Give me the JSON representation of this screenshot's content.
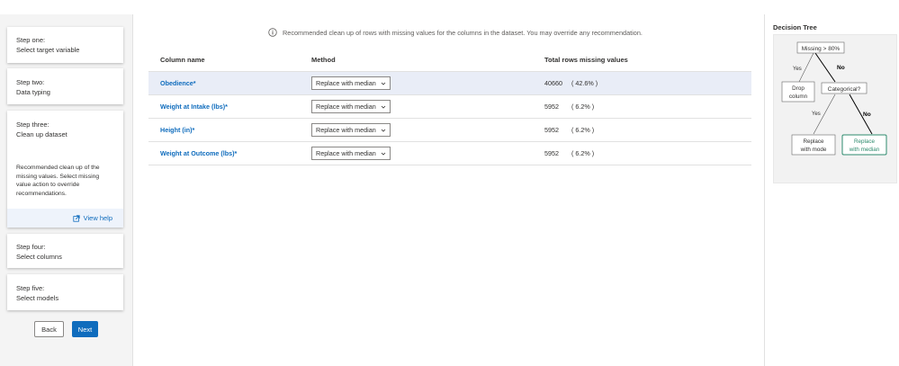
{
  "steps": [
    {
      "label": "Step one:",
      "value": "Select target variable"
    },
    {
      "label": "Step two:",
      "value": "Data typing"
    },
    {
      "label": "Step three:",
      "value": "Clean up dataset",
      "description": "Recommended clean up of the missing values. Select missing value action to override recommendations.",
      "help": "View help"
    },
    {
      "label": "Step four:",
      "value": "Select columns"
    },
    {
      "label": "Step five:",
      "value": "Select models"
    }
  ],
  "buttons": {
    "back": "Back",
    "next": "Next"
  },
  "notice": "Recommended clean up of rows with missing values for the columns in the dataset. You may override any recommendation.",
  "table": {
    "headers": [
      "Column name",
      "Method",
      "Total rows missing values"
    ],
    "rows": [
      {
        "name": "Obedience*",
        "method": "Replace with median",
        "count": "40660",
        "pct": "( 42.6% )",
        "selected": true
      },
      {
        "name": "Weight at Intake (lbs)*",
        "method": "Replace with median",
        "count": "5952",
        "pct": "( 6.2% )",
        "selected": false
      },
      {
        "name": "Height (in)*",
        "method": "Replace with median",
        "count": "5952",
        "pct": "( 6.2% )",
        "selected": false
      },
      {
        "name": "Weight at Outcome (lbs)*",
        "method": "Replace with median",
        "count": "5952",
        "pct": "( 6.2% )",
        "selected": false
      }
    ]
  },
  "decision_tree": {
    "title": "Decision Tree",
    "root": "Missing > 80%",
    "yes1": "Yes",
    "no1": "No",
    "drop_line1": "Drop",
    "drop_line2": "column",
    "categorical": "Categorical?",
    "yes2": "Yes",
    "no2": "No",
    "mode_line1": "Replace",
    "mode_line2": "with mode",
    "median_line1": "Replace",
    "median_line2": "with median",
    "highlight_color": "#2e8b6e"
  },
  "colors": {
    "accent": "#0f6cbd",
    "selected_row": "#e9edf7"
  }
}
